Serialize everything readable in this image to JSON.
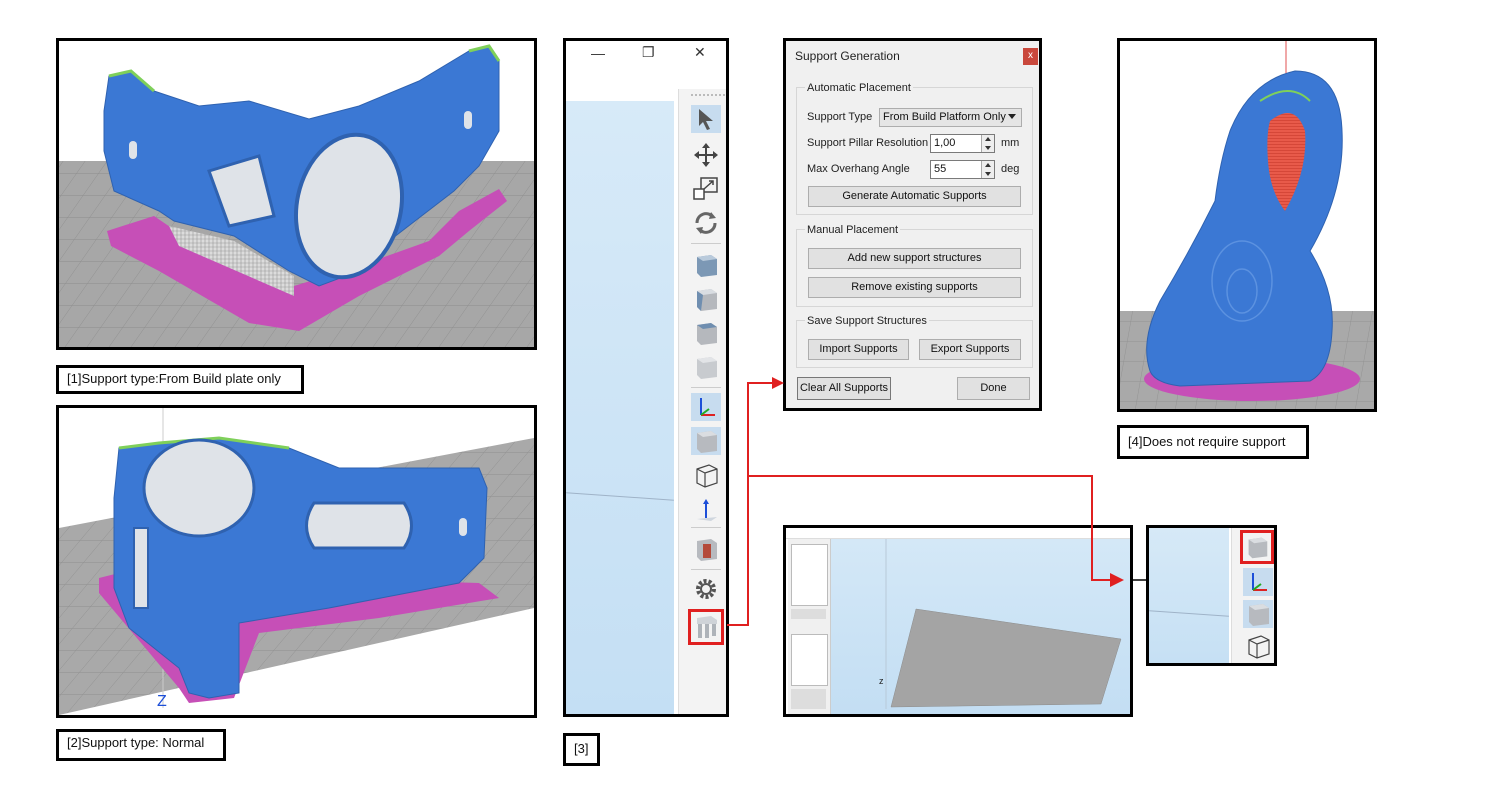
{
  "captions": {
    "c1": "[1]Support type:From Build plate only",
    "c2": "[2]Support type: Normal",
    "c3": "[3]",
    "c4": "[4]Does not require support"
  },
  "dialog": {
    "title": "Support Generation",
    "close": "x",
    "automatic": {
      "title": "Automatic Placement",
      "support_type_label": "Support Type",
      "support_type_value": "From Build Platform Only",
      "resolution_label": "Support Pillar Resolution",
      "resolution_value": "1,00",
      "resolution_unit": "mm",
      "overhang_label": "Max Overhang Angle",
      "overhang_value": "55",
      "overhang_unit": "deg",
      "generate_button": "Generate Automatic Supports"
    },
    "manual": {
      "title": "Manual Placement",
      "add_button": "Add new support structures",
      "remove_button": "Remove existing supports"
    },
    "save": {
      "title": "Save Support Structures",
      "import_button": "Import Supports",
      "export_button": "Export Supports"
    },
    "clear_button": "Clear All Supports",
    "done_button": "Done"
  },
  "window_controls": {
    "minimize": "—",
    "restore": "❐",
    "close": "✕"
  },
  "mini_app": {
    "axis_label": "z"
  },
  "scene2": {
    "axis_label": "Z"
  },
  "colors": {
    "model_blue": "#3b78d4",
    "raft_magenta": "#c64fb7",
    "plate_gray": "#a9a9a9",
    "highlight_red": "#e02020",
    "edge_green": "#7fd05a"
  },
  "icons": [
    "arrow-cursor-icon",
    "move-icon",
    "scale-icon",
    "rotate-icon",
    "view-front-icon",
    "view-side-icon",
    "view-top-icon",
    "view-iso-icon",
    "axes-icon",
    "solid-cube-icon",
    "wireframe-cube-icon",
    "axis-arrow-icon",
    "cut-cube-icon",
    "gear-icon",
    "support-icon"
  ]
}
